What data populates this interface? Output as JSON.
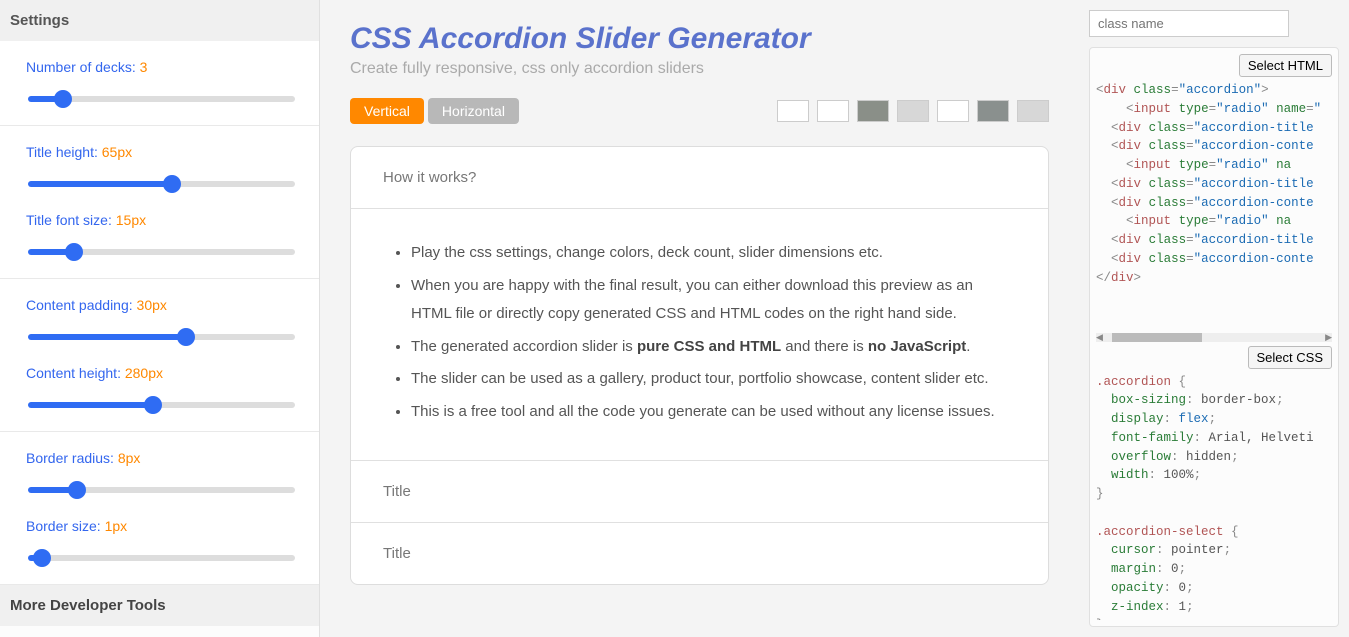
{
  "sidebar": {
    "header": "Settings",
    "more_tools": "More Developer Tools",
    "sliders": [
      {
        "label": "Number of decks:",
        "value": "3",
        "min": 1,
        "max": 20,
        "current": 3
      },
      {
        "label": "Title height:",
        "value": "65px",
        "min": 0,
        "max": 120,
        "current": 65
      },
      {
        "label": "Title font size:",
        "value": "15px",
        "min": 0,
        "max": 100,
        "current": 15
      },
      {
        "label": "Content padding:",
        "value": "30px",
        "min": 0,
        "max": 50,
        "current": 30
      },
      {
        "label": "Content height:",
        "value": "280px",
        "min": 0,
        "max": 600,
        "current": 280
      },
      {
        "label": "Border radius:",
        "value": "8px",
        "min": 0,
        "max": 50,
        "current": 8
      },
      {
        "label": "Border size:",
        "value": "1px",
        "min": 0,
        "max": 50,
        "current": 1
      }
    ],
    "groups": [
      [
        0
      ],
      [
        1,
        2
      ],
      [
        3,
        4
      ],
      [
        5,
        6
      ]
    ]
  },
  "center": {
    "title": "CSS Accordion Slider Generator",
    "subtitle": "Create fully responsive, css only accordion sliders",
    "orientations": [
      {
        "label": "Vertical",
        "active": true
      },
      {
        "label": "Horizontal",
        "active": false
      }
    ],
    "swatches": [
      "#ffffff",
      "#ffffff",
      "#8a8f88",
      "#d7d7d7",
      "#ffffff",
      "#8a908e",
      "#d7d7d7"
    ],
    "accordion": {
      "title1": "How it works?",
      "bullets": [
        {
          "kind": "plain",
          "text": "Play the css settings, change colors, deck count, slider dimensions etc."
        },
        {
          "kind": "plain",
          "text": "When you are happy with the final result, you can either download this preview as an HTML file or directly copy generated CSS and HTML codes on the right hand side."
        },
        {
          "kind": "html",
          "text": "The generated accordion slider is <strong>pure CSS and HTML</strong> and there is <strong>no JavaScript</strong>."
        },
        {
          "kind": "plain",
          "text": "The slider can be used as a gallery, product tour, portfolio showcase, content slider etc."
        },
        {
          "kind": "plain",
          "text": "This is a free tool and all the code you generate can be used without any license issues."
        }
      ],
      "title2": "Title",
      "title3": "Title"
    }
  },
  "right": {
    "class_placeholder": "class name",
    "select_html": "Select HTML",
    "select_css": "Select CSS",
    "html_lines": [
      [
        {
          "p": "<"
        },
        {
          "tag": "div"
        },
        {
          "sp": " "
        },
        {
          "attr": "class"
        },
        {
          "p": "="
        },
        {
          "str": "\"accordion\""
        },
        {
          "p": ">"
        }
      ],
      [
        {
          "ind": 2
        },
        {
          "p": "<"
        },
        {
          "tag": "input"
        },
        {
          "sp": " "
        },
        {
          "attr": "type"
        },
        {
          "p": "="
        },
        {
          "str": "\"radio\""
        },
        {
          "sp": " "
        },
        {
          "attr": "name"
        },
        {
          "p": "="
        },
        {
          "str": "\""
        }
      ],
      [
        {
          "ind": 1
        },
        {
          "p": "<"
        },
        {
          "tag": "div"
        },
        {
          "sp": " "
        },
        {
          "attr": "class"
        },
        {
          "p": "="
        },
        {
          "str": "\"accordion-title"
        }
      ],
      [
        {
          "ind": 1
        },
        {
          "p": "<"
        },
        {
          "tag": "div"
        },
        {
          "sp": " "
        },
        {
          "attr": "class"
        },
        {
          "p": "="
        },
        {
          "str": "\"accordion-conte"
        }
      ],
      [
        {
          "ind": 2
        },
        {
          "p": "<"
        },
        {
          "tag": "input"
        },
        {
          "sp": " "
        },
        {
          "attr": "type"
        },
        {
          "p": "="
        },
        {
          "str": "\"radio\""
        },
        {
          "sp": " "
        },
        {
          "attr": "na"
        }
      ],
      [
        {
          "ind": 1
        },
        {
          "p": "<"
        },
        {
          "tag": "div"
        },
        {
          "sp": " "
        },
        {
          "attr": "class"
        },
        {
          "p": "="
        },
        {
          "str": "\"accordion-title"
        }
      ],
      [
        {
          "ind": 1
        },
        {
          "p": "<"
        },
        {
          "tag": "div"
        },
        {
          "sp": " "
        },
        {
          "attr": "class"
        },
        {
          "p": "="
        },
        {
          "str": "\"accordion-conte"
        }
      ],
      [
        {
          "ind": 2
        },
        {
          "p": "<"
        },
        {
          "tag": "input"
        },
        {
          "sp": " "
        },
        {
          "attr": "type"
        },
        {
          "p": "="
        },
        {
          "str": "\"radio\""
        },
        {
          "sp": " "
        },
        {
          "attr": "na"
        }
      ],
      [
        {
          "ind": 1
        },
        {
          "p": "<"
        },
        {
          "tag": "div"
        },
        {
          "sp": " "
        },
        {
          "attr": "class"
        },
        {
          "p": "="
        },
        {
          "str": "\"accordion-title"
        }
      ],
      [
        {
          "ind": 1
        },
        {
          "p": "<"
        },
        {
          "tag": "div"
        },
        {
          "sp": " "
        },
        {
          "attr": "class"
        },
        {
          "p": "="
        },
        {
          "str": "\"accordion-conte"
        }
      ],
      [
        {
          "p": "</"
        },
        {
          "tag": "div"
        },
        {
          "p": ">"
        }
      ]
    ],
    "css_lines": [
      [
        {
          "sel": ".accordion"
        },
        {
          "sp": " "
        },
        {
          "p": "{"
        }
      ],
      [
        {
          "ind": 1
        },
        {
          "prop": "box-sizing"
        },
        {
          "p": ": "
        },
        {
          "val": "border-box"
        },
        {
          "p": ";"
        }
      ],
      [
        {
          "ind": 1
        },
        {
          "prop": "display"
        },
        {
          "p": ": "
        },
        {
          "key": "flex"
        },
        {
          "p": ";"
        }
      ],
      [
        {
          "ind": 1
        },
        {
          "prop": "font-family"
        },
        {
          "p": ": "
        },
        {
          "val": "Arial, Helveti"
        }
      ],
      [
        {
          "ind": 1
        },
        {
          "prop": "overflow"
        },
        {
          "p": ": "
        },
        {
          "val": "hidden"
        },
        {
          "p": ";"
        }
      ],
      [
        {
          "ind": 1
        },
        {
          "prop": "width"
        },
        {
          "p": ": "
        },
        {
          "val": "100%"
        },
        {
          "p": ";"
        }
      ],
      [
        {
          "p": "}"
        }
      ],
      [
        {
          "sp": " "
        }
      ],
      [
        {
          "sel": ".accordion-select"
        },
        {
          "sp": " "
        },
        {
          "p": "{"
        }
      ],
      [
        {
          "ind": 1
        },
        {
          "prop": "cursor"
        },
        {
          "p": ": "
        },
        {
          "val": "pointer"
        },
        {
          "p": ";"
        }
      ],
      [
        {
          "ind": 1
        },
        {
          "prop": "margin"
        },
        {
          "p": ": "
        },
        {
          "val": "0"
        },
        {
          "p": ";"
        }
      ],
      [
        {
          "ind": 1
        },
        {
          "prop": "opacity"
        },
        {
          "p": ": "
        },
        {
          "val": "0"
        },
        {
          "p": ";"
        }
      ],
      [
        {
          "ind": 1
        },
        {
          "prop": "z-index"
        },
        {
          "p": ": "
        },
        {
          "val": "1"
        },
        {
          "p": ";"
        }
      ],
      [
        {
          "p": "}"
        }
      ]
    ]
  }
}
